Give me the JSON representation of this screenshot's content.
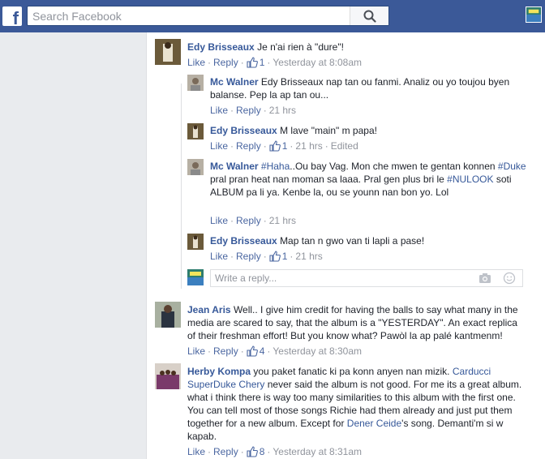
{
  "header": {
    "logo_letter": "f",
    "search_placeholder": "Search Facebook"
  },
  "actions": {
    "like": "Like",
    "reply": "Reply",
    "sep": "·"
  },
  "comments": [
    {
      "author": "Edy Brisseaux",
      "text": "Je n'ai rien à \"dure\"!",
      "likes": "1",
      "time": "Yesterday at 8:08am",
      "replies": [
        {
          "author": "Mc Walner",
          "text": "Edy Brisseaux nap tan ou fanmi. Analiz ou yo toujou byen balanse. Pep la ap tan ou...",
          "time": "21 hrs"
        },
        {
          "author": "Edy Brisseaux",
          "text": "M lave \"main\" m papa!",
          "likes": "1",
          "time": "21 hrs",
          "edited": "Edited"
        },
        {
          "author": "Mc Walner",
          "parts": [
            "#Haha",
            "..Ou bay Vag. Mon che mwen te gentan konnen ",
            "#Duke",
            " pral pran heat nan moman sa laaa. Pral gen plus bri le ",
            "#NULOOK",
            " soti ALBUM pa li ya. Kenbe la, ou se younn nan bon yo. Lol"
          ],
          "time": "21 hrs"
        },
        {
          "author": "Edy Brisseaux",
          "text": "Map tan n gwo van ti lapli a pase!",
          "likes": "1",
          "time": "21 hrs"
        }
      ],
      "write_reply_placeholder": "Write a reply..."
    },
    {
      "author": "Jean Aris",
      "text": "Well.. I give him credit for having the balls to say what many in the media are scared to say, that the album is a \"YESTERDAY\". An exact replica of their freshman effort! But you know what? Pawòl la ap palé kantmenm!",
      "likes": "4",
      "time": "Yesterday at 8:30am"
    },
    {
      "author": "Herby Kompa",
      "parts": [
        "you paket fanatic ki pa konn anyen nan mizik. ",
        "Carducci SuperDuke Chery",
        " never said the album is not good. For me its a great album. what i think there is way too many similarities to this album with the first one. You can tell most of those songs Richie had them already and just put them together for a new album. Except for ",
        "Dener Ceide",
        "'s song. Demanti'm si w kapab."
      ],
      "likes": "8",
      "time": "Yesterday at 8:31am"
    }
  ],
  "colors": {
    "brand": "#3b5998",
    "link": "#365899",
    "meta": "#90949c"
  }
}
